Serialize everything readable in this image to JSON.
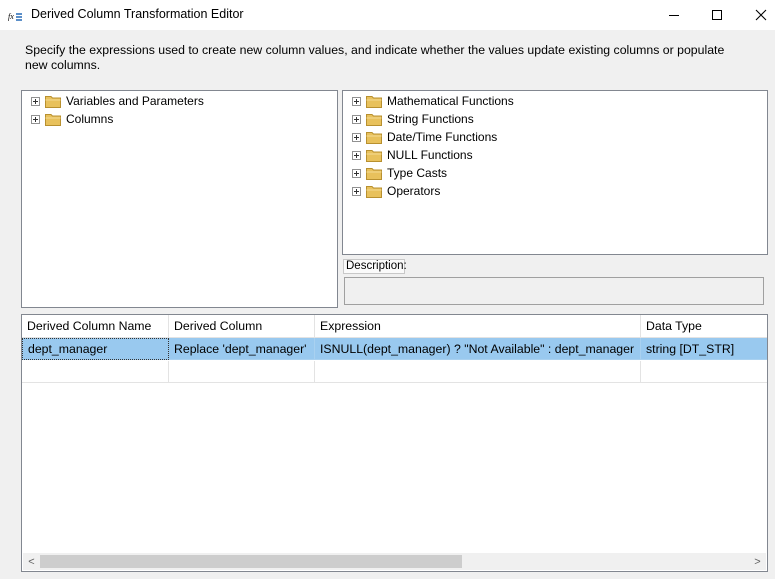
{
  "window": {
    "title": "Derived Column Transformation Editor"
  },
  "instructions": "Specify the expressions used to create new column values, and indicate whether the values update existing columns or populate new columns.",
  "left_tree": {
    "items": [
      {
        "label": "Variables and Parameters",
        "icon": "folder-icon"
      },
      {
        "label": "Columns",
        "icon": "folder-icon"
      }
    ]
  },
  "right_tree": {
    "items": [
      {
        "label": "Mathematical Functions",
        "icon": "folder-icon"
      },
      {
        "label": "String Functions",
        "icon": "folder-icon"
      },
      {
        "label": "Date/Time Functions",
        "icon": "folder-icon"
      },
      {
        "label": "NULL Functions",
        "icon": "folder-icon"
      },
      {
        "label": "Type Casts",
        "icon": "folder-icon"
      },
      {
        "label": "Operators",
        "icon": "folder-icon"
      }
    ]
  },
  "description": {
    "label": "Description:",
    "value": ""
  },
  "grid": {
    "columns": [
      "Derived Column Name",
      "Derived Column",
      "Expression",
      "Data Type"
    ],
    "rows": [
      [
        "dept_manager",
        "Replace 'dept_manager'",
        "ISNULL(dept_manager) ? \"Not Available\" : dept_manager",
        "string [DT_STR]"
      ]
    ]
  },
  "colors": {
    "selected_row": "#99c9ef",
    "folder": "#e8c15c"
  }
}
